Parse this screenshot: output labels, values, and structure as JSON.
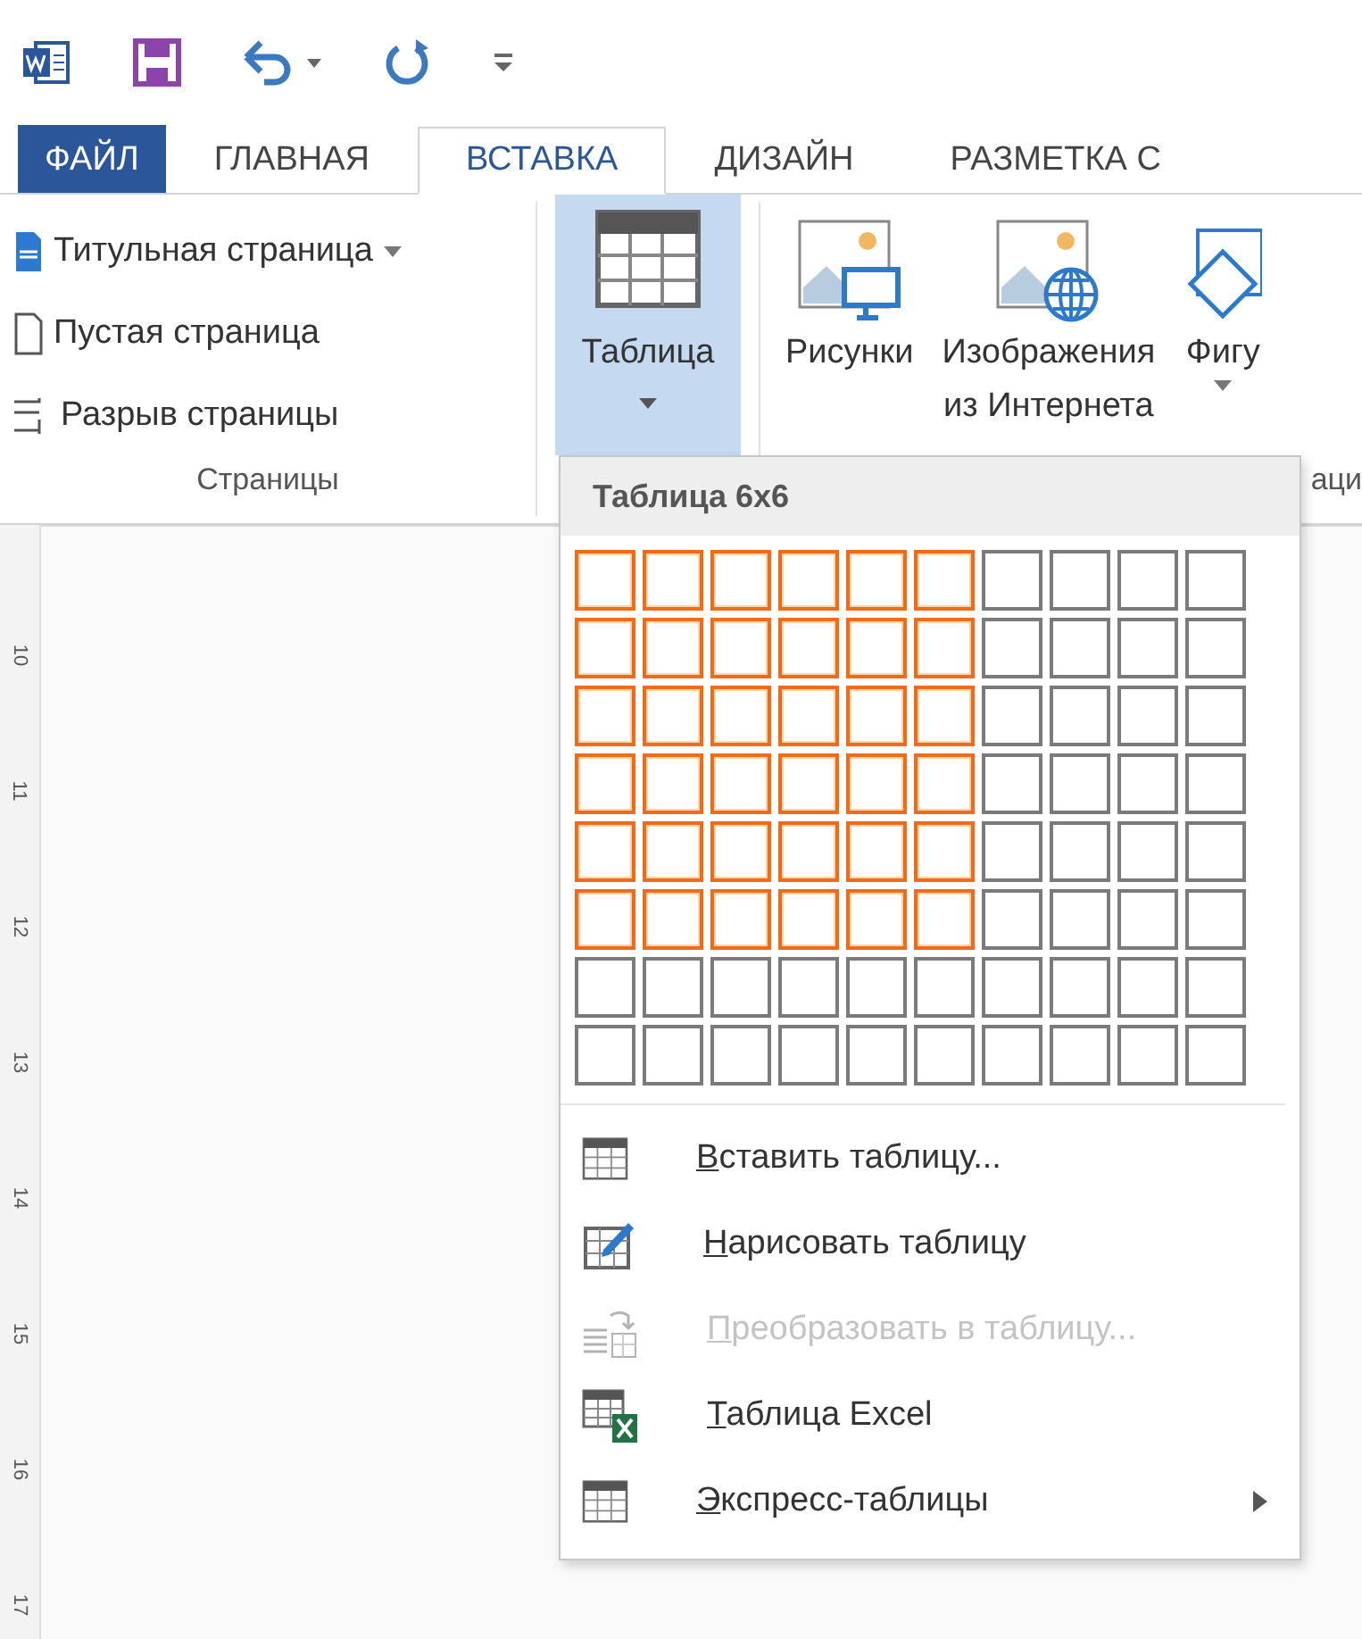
{
  "quick_access": [
    {
      "kind": "word"
    },
    {
      "kind": "save"
    },
    {
      "kind": "undo"
    },
    {
      "kind": "redo"
    },
    {
      "kind": "customize"
    }
  ],
  "tabs": [
    {
      "label": "ФАЙЛ",
      "kind": "file",
      "selected": false
    },
    {
      "label": "ГЛАВНАЯ",
      "kind": "tab",
      "selected": false
    },
    {
      "label": "ВСТАВКА",
      "kind": "tab",
      "selected": true
    },
    {
      "label": "ДИЗАЙН",
      "kind": "tab",
      "selected": false
    },
    {
      "label": "РАЗМЕТКА С",
      "kind": "tab",
      "selected": false
    }
  ],
  "ribbon": {
    "pages_group": {
      "items": [
        {
          "label": "Титульная страница",
          "kind": "cover",
          "dropdown": true
        },
        {
          "label": "Пустая страница",
          "kind": "blank",
          "dropdown": false
        },
        {
          "label": "Разрыв страницы",
          "kind": "break",
          "dropdown": false
        }
      ],
      "label": "Страницы"
    },
    "table_button": {
      "label": "Таблица",
      "selected": true
    },
    "illustrations": [
      {
        "label": "Рисунки",
        "kind": "pictures",
        "dropdown": false
      },
      {
        "label": "Изображения\nиз Интернета",
        "kind": "online",
        "dropdown": false
      },
      {
        "label": "Фигу",
        "kind": "shapes",
        "dropdown": true
      }
    ],
    "illustrations_group_label": "аци"
  },
  "ruler_labels": [
    "10",
    "11",
    "12",
    "13",
    "14",
    "15",
    "16",
    "17"
  ],
  "table_menu": {
    "header": "Таблица 6x6",
    "grid": [
      {
        "cells": [
          {
            "selected": true
          },
          {
            "selected": true
          },
          {
            "selected": true
          },
          {
            "selected": true
          },
          {
            "selected": true
          },
          {
            "selected": true
          },
          {
            "selected": false
          },
          {
            "selected": false
          },
          {
            "selected": false
          },
          {
            "selected": false
          }
        ]
      },
      {
        "cells": [
          {
            "selected": true
          },
          {
            "selected": true
          },
          {
            "selected": true
          },
          {
            "selected": true
          },
          {
            "selected": true
          },
          {
            "selected": true
          },
          {
            "selected": false
          },
          {
            "selected": false
          },
          {
            "selected": false
          },
          {
            "selected": false
          }
        ]
      },
      {
        "cells": [
          {
            "selected": true
          },
          {
            "selected": true
          },
          {
            "selected": true
          },
          {
            "selected": true
          },
          {
            "selected": true
          },
          {
            "selected": true
          },
          {
            "selected": false
          },
          {
            "selected": false
          },
          {
            "selected": false
          },
          {
            "selected": false
          }
        ]
      },
      {
        "cells": [
          {
            "selected": true
          },
          {
            "selected": true
          },
          {
            "selected": true
          },
          {
            "selected": true
          },
          {
            "selected": true
          },
          {
            "selected": true
          },
          {
            "selected": false
          },
          {
            "selected": false
          },
          {
            "selected": false
          },
          {
            "selected": false
          }
        ]
      },
      {
        "cells": [
          {
            "selected": true
          },
          {
            "selected": true
          },
          {
            "selected": true
          },
          {
            "selected": true
          },
          {
            "selected": true
          },
          {
            "selected": true
          },
          {
            "selected": false
          },
          {
            "selected": false
          },
          {
            "selected": false
          },
          {
            "selected": false
          }
        ]
      },
      {
        "cells": [
          {
            "selected": true
          },
          {
            "selected": true
          },
          {
            "selected": true
          },
          {
            "selected": true
          },
          {
            "selected": true
          },
          {
            "selected": true
          },
          {
            "selected": false
          },
          {
            "selected": false
          },
          {
            "selected": false
          },
          {
            "selected": false
          }
        ]
      },
      {
        "cells": [
          {
            "selected": false
          },
          {
            "selected": false
          },
          {
            "selected": false
          },
          {
            "selected": false
          },
          {
            "selected": false
          },
          {
            "selected": false
          },
          {
            "selected": false
          },
          {
            "selected": false
          },
          {
            "selected": false
          },
          {
            "selected": false
          }
        ]
      },
      {
        "cells": [
          {
            "selected": false
          },
          {
            "selected": false
          },
          {
            "selected": false
          },
          {
            "selected": false
          },
          {
            "selected": false
          },
          {
            "selected": false
          },
          {
            "selected": false
          },
          {
            "selected": false
          },
          {
            "selected": false
          },
          {
            "selected": false
          }
        ]
      }
    ],
    "items": [
      {
        "label": "Вставить таблицу...",
        "kind": "insert",
        "disabled": false,
        "submenu": false
      },
      {
        "label": "Нарисовать таблицу",
        "kind": "draw",
        "disabled": false,
        "submenu": false
      },
      {
        "label": "Преобразовать в таблицу...",
        "kind": "convert",
        "disabled": true,
        "submenu": false
      },
      {
        "label": "Таблица Excel",
        "kind": "excel",
        "disabled": false,
        "submenu": false
      },
      {
        "label": "Экспресс-таблицы",
        "kind": "quick",
        "disabled": false,
        "submenu": true
      }
    ]
  }
}
